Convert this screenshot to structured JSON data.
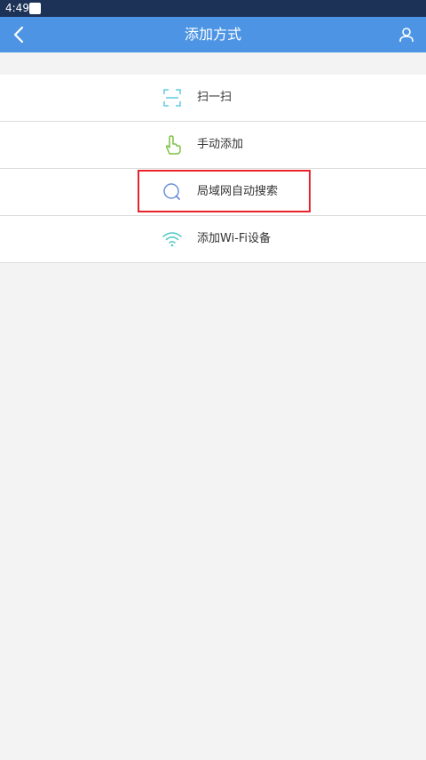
{
  "status_bar": {
    "time": "4:49"
  },
  "app_bar": {
    "title": "添加方式",
    "back_icon": "chevron-left-icon",
    "user_icon": "user-icon"
  },
  "menu": {
    "items": [
      {
        "label": "扫一扫",
        "icon": "scan-icon",
        "icon_color": "#5ec8e8"
      },
      {
        "label": "手动添加",
        "icon": "hand-pointer-icon",
        "icon_color": "#7dc242"
      },
      {
        "label": "局域网自动搜索",
        "icon": "search-icon",
        "icon_color": "#6a8fd8"
      },
      {
        "label": "添加Wi-Fi设备",
        "icon": "wifi-icon",
        "icon_color": "#4fc7c3"
      }
    ]
  },
  "colors": {
    "status_bar": "#1c3357",
    "app_bar": "#4d95e4",
    "background": "#f3f3f3",
    "highlight": "#e8232b"
  }
}
